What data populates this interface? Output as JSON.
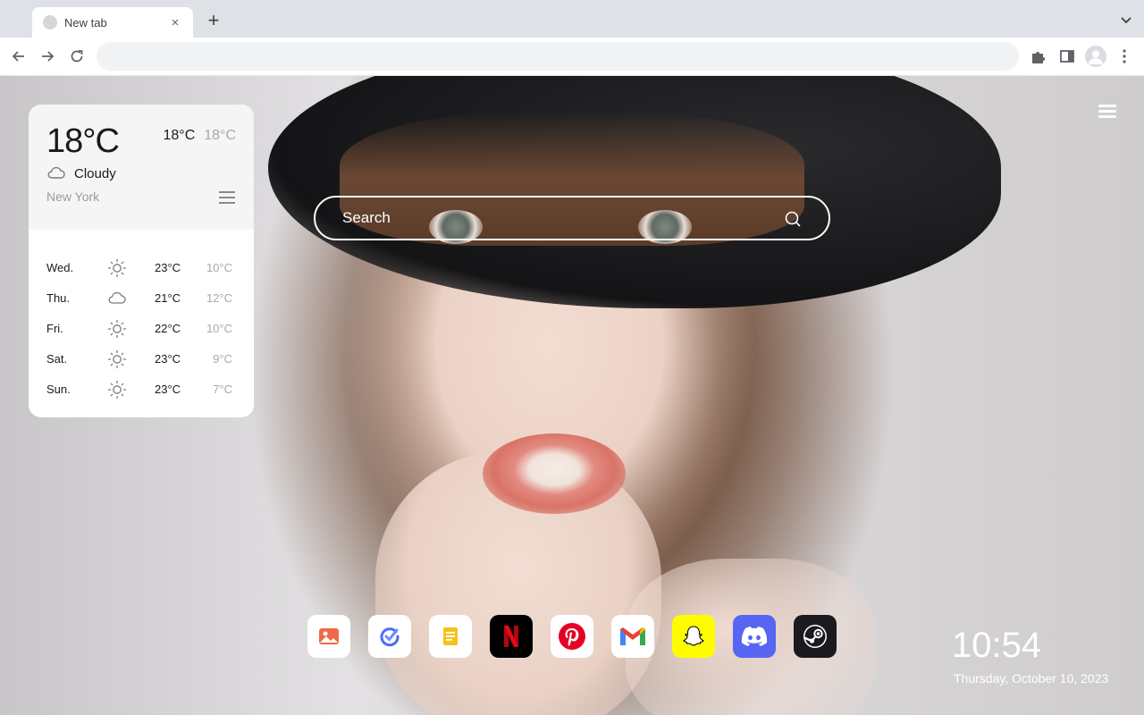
{
  "browser": {
    "tab_title": "New tab",
    "tab_close": "×",
    "new_tab": "+",
    "omnibox_value": "",
    "omnibox_placeholder": ""
  },
  "weather": {
    "current_temp": "18°C",
    "high": "18°C",
    "low": "18°C",
    "condition": "Cloudy",
    "condition_icon": "cloud-icon",
    "city": "New York",
    "forecast": [
      {
        "day": "Wed.",
        "icon": "sun-icon",
        "high": "23°C",
        "low": "10°C"
      },
      {
        "day": "Thu.",
        "icon": "cloud-icon",
        "high": "21°C",
        "low": "12°C"
      },
      {
        "day": "Fri.",
        "icon": "sun-icon",
        "high": "22°C",
        "low": "10°C"
      },
      {
        "day": "Sat.",
        "icon": "sun-icon",
        "high": "23°C",
        "low": "9°C"
      },
      {
        "day": "Sun.",
        "icon": "sun-icon",
        "high": "23°C",
        "low": "7°C"
      }
    ]
  },
  "search": {
    "placeholder": "Search"
  },
  "dock": [
    {
      "name": "photos-shortcut",
      "icon": "image-icon",
      "bg": "#ffffff",
      "accent": "#e8553a"
    },
    {
      "name": "tasks-shortcut",
      "icon": "check-circle-icon",
      "bg": "#ffffff",
      "accent": "#4a6cf7"
    },
    {
      "name": "notes-shortcut",
      "icon": "note-icon",
      "bg": "#ffffff",
      "accent": "#f2b705"
    },
    {
      "name": "netflix-shortcut",
      "icon": "netflix-icon",
      "bg": "#000000",
      "accent": "#e50914"
    },
    {
      "name": "pinterest-shortcut",
      "icon": "pinterest-icon",
      "bg": "#ffffff",
      "accent": "#e60023"
    },
    {
      "name": "gmail-shortcut",
      "icon": "gmail-icon",
      "bg": "#ffffff",
      "accent": "#ea4335"
    },
    {
      "name": "snapchat-shortcut",
      "icon": "snapchat-icon",
      "bg": "#fffc00",
      "accent": "#ffffff"
    },
    {
      "name": "discord-shortcut",
      "icon": "discord-icon",
      "bg": "#5865f2",
      "accent": "#ffffff"
    },
    {
      "name": "steam-shortcut",
      "icon": "steam-icon",
      "bg": "#1b1b1f",
      "accent": "#ffffff"
    }
  ],
  "clock": {
    "time": "10:54",
    "date": "Thursday, October 10, 2023"
  }
}
